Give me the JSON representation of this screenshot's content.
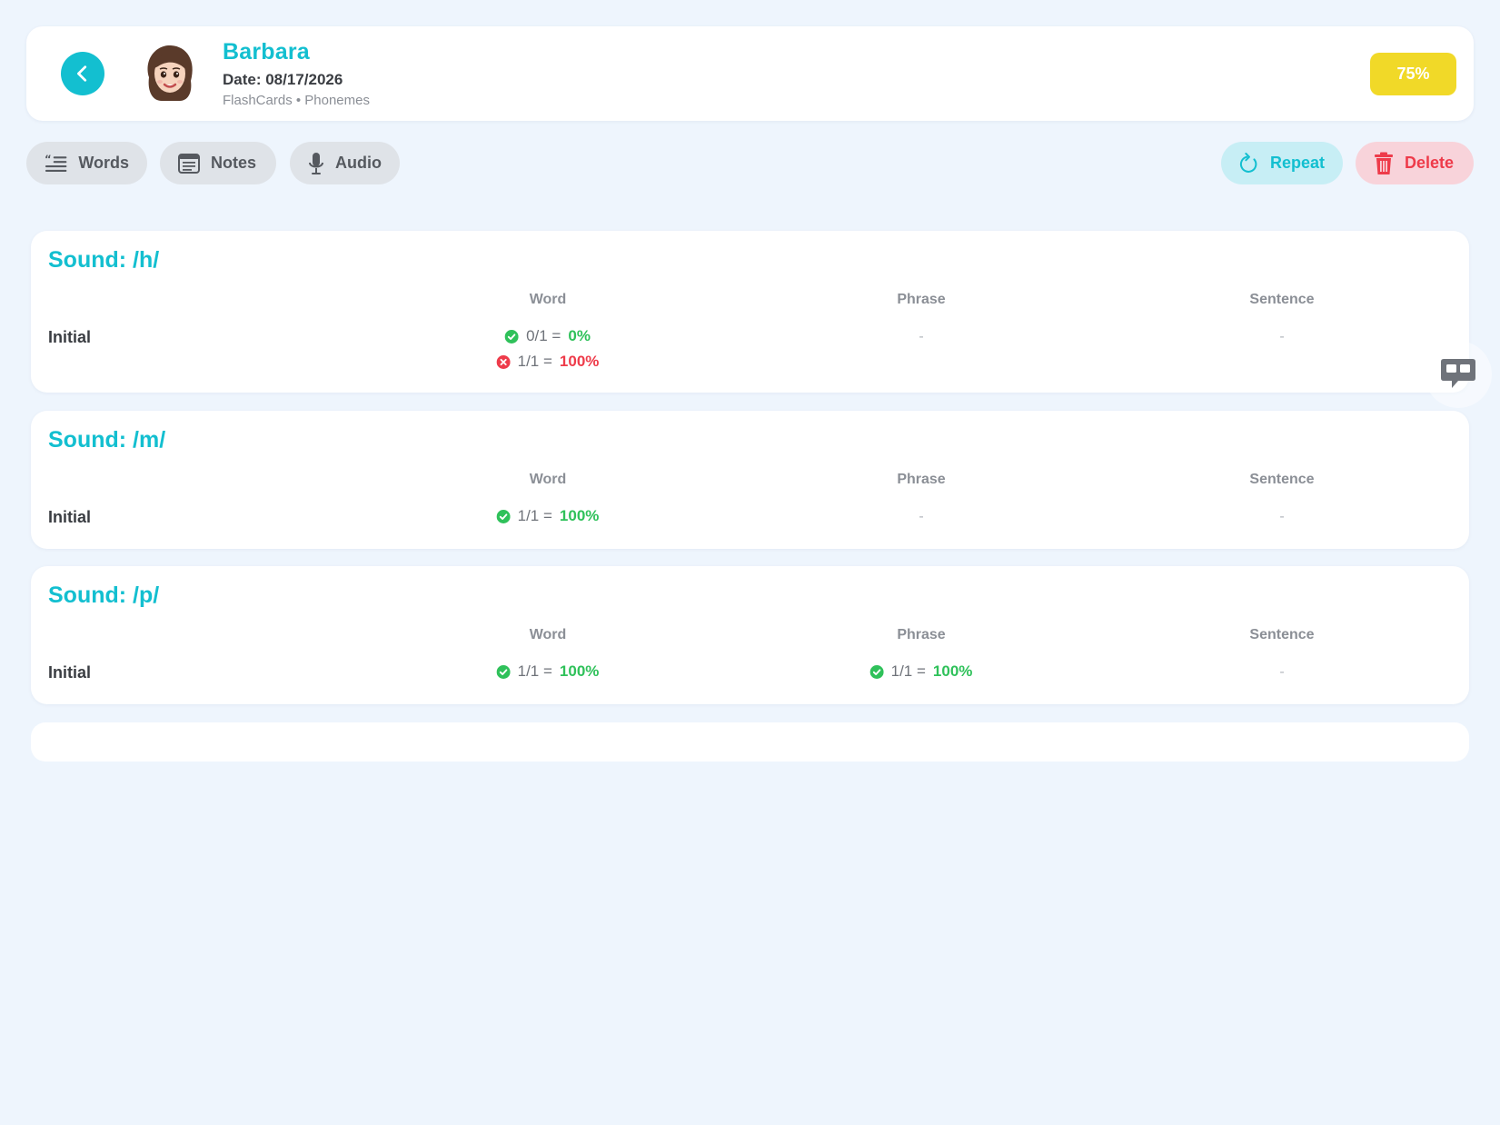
{
  "header": {
    "name": "Barbara",
    "date": "Date: 08/17/2026",
    "subtitle": "FlashCards • Phonemes",
    "score": "75%"
  },
  "toolbar": {
    "words": "Words",
    "notes": "Notes",
    "audio": "Audio",
    "repeat": "Repeat",
    "delete": "Delete"
  },
  "columns": [
    "Word",
    "Phrase",
    "Sentence"
  ],
  "sounds": [
    {
      "title": "Sound: /h/",
      "row_label": "Initial",
      "word": [
        {
          "status": "correct",
          "fraction": "0/1 =",
          "percent": "0%"
        },
        {
          "status": "incorrect",
          "fraction": "1/1 =",
          "percent": "100%"
        }
      ],
      "phrase": "-",
      "sentence": "-"
    },
    {
      "title": "Sound: /m/",
      "row_label": "Initial",
      "word": [
        {
          "status": "correct",
          "fraction": "1/1 =",
          "percent": "100%"
        }
      ],
      "phrase": "-",
      "sentence": "-"
    },
    {
      "title": "Sound: /p/",
      "row_label": "Initial",
      "word": [
        {
          "status": "correct",
          "fraction": "1/1 =",
          "percent": "100%"
        }
      ],
      "phrase_result": {
        "status": "correct",
        "fraction": "1/1 =",
        "percent": "100%"
      },
      "sentence": "-"
    }
  ],
  "colors": {
    "accent": "#13bfd0",
    "score": "#f1d928",
    "correct": "#2fc15a",
    "incorrect": "#ee3b4a"
  }
}
